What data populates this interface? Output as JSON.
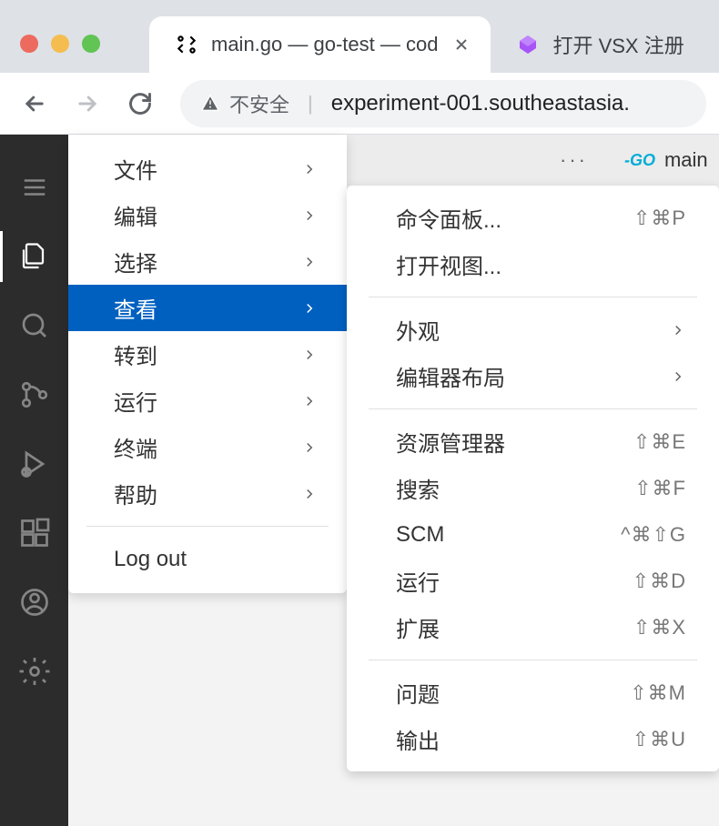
{
  "browser": {
    "tabs": [
      {
        "title": "main.go — go-test — cod",
        "active": true
      },
      {
        "title": "打开 VSX 注册",
        "active": false
      }
    ],
    "security_label": "不安全",
    "url": "experiment-001.southeastasia."
  },
  "editor": {
    "open_file": "main"
  },
  "menu": {
    "items": [
      {
        "label": "文件",
        "submenu": true
      },
      {
        "label": "编辑",
        "submenu": true
      },
      {
        "label": "选择",
        "submenu": true
      },
      {
        "label": "查看",
        "submenu": true,
        "highlighted": true
      },
      {
        "label": "转到",
        "submenu": true
      },
      {
        "label": "运行",
        "submenu": true
      },
      {
        "label": "终端",
        "submenu": true
      },
      {
        "label": "帮助",
        "submenu": true
      }
    ],
    "logout": "Log out"
  },
  "submenu": {
    "items": [
      {
        "label": "命令面板...",
        "shortcut": "⇧⌘P"
      },
      {
        "label": "打开视图...",
        "shortcut": ""
      },
      {
        "separator": true
      },
      {
        "label": "外观",
        "submenu": true
      },
      {
        "label": "编辑器布局",
        "submenu": true
      },
      {
        "separator": true
      },
      {
        "label": "资源管理器",
        "shortcut": "⇧⌘E"
      },
      {
        "label": "搜索",
        "shortcut": "⇧⌘F"
      },
      {
        "label": "SCM",
        "shortcut": "^⌘⇧G"
      },
      {
        "label": "运行",
        "shortcut": "⇧⌘D"
      },
      {
        "label": "扩展",
        "shortcut": "⇧⌘X"
      },
      {
        "separator": true
      },
      {
        "label": "问题",
        "shortcut": "⇧⌘M"
      },
      {
        "label": "输出",
        "shortcut": "⇧⌘U"
      }
    ]
  }
}
